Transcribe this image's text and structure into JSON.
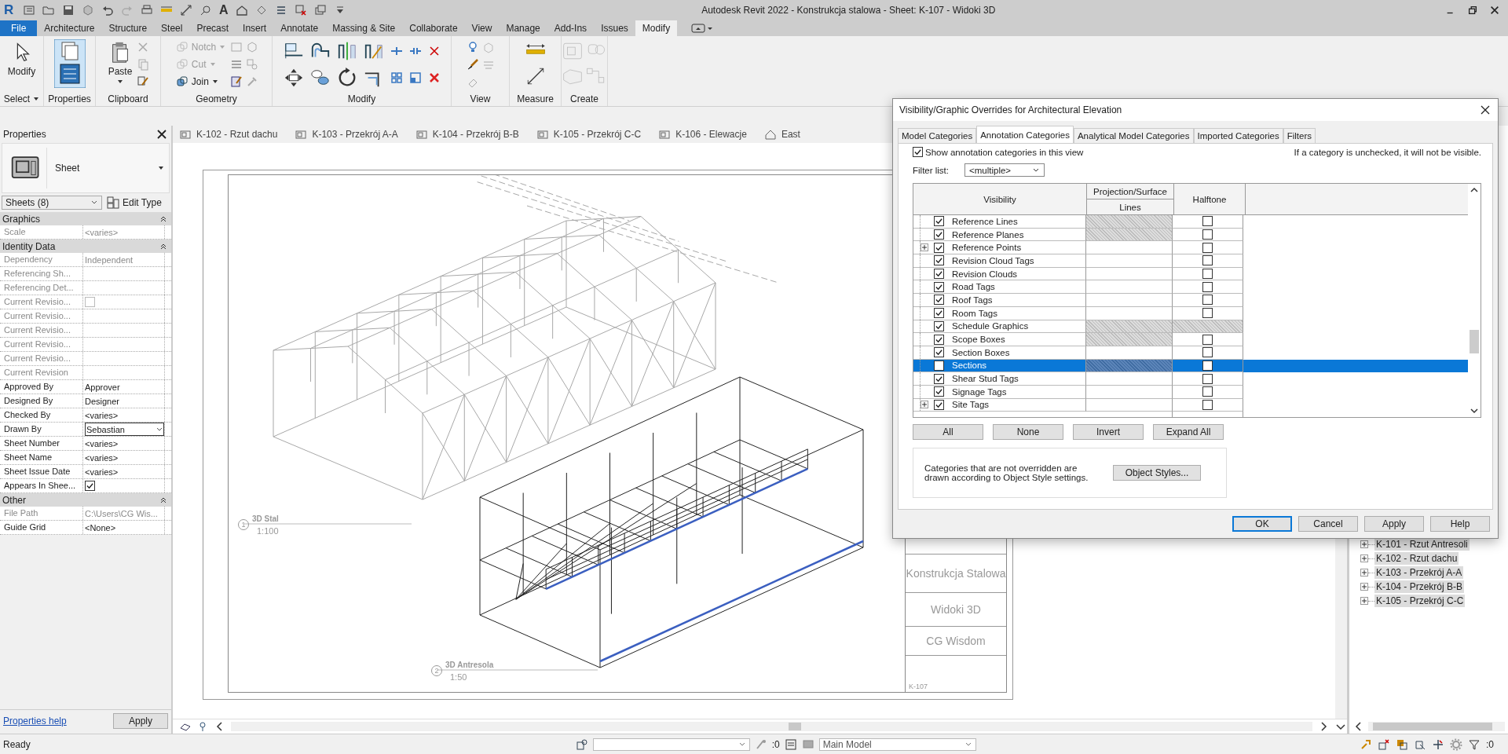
{
  "window": {
    "logo": "R",
    "text_tool": "A",
    "title": "Autodesk Revit 2022 - Konstrukcja stalowa - Sheet: K-107 - Widoki 3D"
  },
  "ribbon_tabs": [
    {
      "label": "File",
      "kind": "file",
      "selected": false
    },
    {
      "label": "Architecture",
      "kind": "tab",
      "selected": false
    },
    {
      "label": "Structure",
      "kind": "tab",
      "selected": false
    },
    {
      "label": "Steel",
      "kind": "tab",
      "selected": false
    },
    {
      "label": "Precast",
      "kind": "tab",
      "selected": false
    },
    {
      "label": "Insert",
      "kind": "tab",
      "selected": false
    },
    {
      "label": "Annotate",
      "kind": "tab",
      "selected": false
    },
    {
      "label": "Massing & Site",
      "kind": "tab",
      "selected": false
    },
    {
      "label": "Collaborate",
      "kind": "tab",
      "selected": false
    },
    {
      "label": "View",
      "kind": "tab",
      "selected": false
    },
    {
      "label": "Manage",
      "kind": "tab",
      "selected": false
    },
    {
      "label": "Add-Ins",
      "kind": "tab",
      "selected": false
    },
    {
      "label": "Issues",
      "kind": "tab",
      "selected": false
    },
    {
      "label": "Modify",
      "kind": "tab",
      "selected": true
    }
  ],
  "ribbon_panels": [
    {
      "kind": "select",
      "label": "Select",
      "tool": "Modify",
      "has_menu": true
    },
    {
      "kind": "properties",
      "label": "Properties",
      "on": true
    },
    {
      "kind": "clipboard",
      "label": "Clipboard",
      "tool": "Paste"
    },
    {
      "kind": "geometry",
      "label": "Geometry",
      "tools": [
        {
          "label": "Notch",
          "disabled": true
        },
        {
          "label": "Cut",
          "disabled": true
        },
        {
          "label": "Join",
          "disabled": false
        }
      ]
    },
    {
      "kind": "modify",
      "label": "Modify"
    },
    {
      "kind": "view",
      "label": "View"
    },
    {
      "kind": "measure",
      "label": "Measure"
    },
    {
      "kind": "create",
      "label": "Create"
    }
  ],
  "properties": {
    "title": "Properties",
    "type_name": "Sheet",
    "selector": "Sheets (8)",
    "edit_type": "Edit Type",
    "groups": [
      {
        "name": "Graphics",
        "expanded": true,
        "rows": [
          {
            "label": "Scale",
            "value": "<varies>",
            "kind": "text",
            "disabled": true
          }
        ]
      },
      {
        "name": "Identity Data",
        "expanded": true,
        "rows": [
          {
            "label": "Dependency",
            "value": "Independent",
            "kind": "text",
            "disabled": true
          },
          {
            "label": "Referencing Sh...",
            "kind": "text",
            "disabled": true
          },
          {
            "label": "Referencing Det...",
            "kind": "text",
            "disabled": true
          },
          {
            "label": "Current Revisio...",
            "kind": "checkbox",
            "checked": false,
            "disabled": true
          },
          {
            "label": "Current Revisio...",
            "kind": "text",
            "disabled": true
          },
          {
            "label": "Current Revisio...",
            "kind": "text",
            "disabled": true
          },
          {
            "label": "Current Revisio...",
            "kind": "text",
            "disabled": true
          },
          {
            "label": "Current Revisio...",
            "kind": "text",
            "disabled": true
          },
          {
            "label": "Current Revision",
            "kind": "text",
            "disabled": true
          },
          {
            "label": "Approved By",
            "value": "Approver",
            "kind": "text",
            "disabled": false
          },
          {
            "label": "Designed By",
            "value": "Designer",
            "kind": "text",
            "disabled": false
          },
          {
            "label": "Checked By",
            "value": "<varies>",
            "kind": "text",
            "disabled": false
          },
          {
            "label": "Drawn By",
            "value": "Sebastian",
            "kind": "dropdown",
            "disabled": false
          },
          {
            "label": "Sheet Number",
            "value": "<varies>",
            "kind": "text",
            "disabled": false
          },
          {
            "label": "Sheet Name",
            "value": "<varies>",
            "kind": "text",
            "disabled": false
          },
          {
            "label": "Sheet Issue Date",
            "value": "<varies>",
            "kind": "text",
            "disabled": false
          },
          {
            "label": "Appears In Shee...",
            "kind": "checkbox",
            "checked": true,
            "disabled": false
          }
        ]
      },
      {
        "name": "Other",
        "expanded": true,
        "rows": [
          {
            "label": "File Path",
            "value": "C:\\Users\\CG Wis...",
            "kind": "text",
            "disabled": true
          },
          {
            "label": "Guide Grid",
            "value": "<None>",
            "kind": "text",
            "disabled": false
          }
        ]
      }
    ],
    "help_link": "Properties help",
    "apply": "Apply"
  },
  "view_tabs": [
    {
      "label": "K-102 - Rzut dachu",
      "kind": "sheet"
    },
    {
      "label": "K-103 - Przekrój A-A",
      "kind": "sheet"
    },
    {
      "label": "K-104 - Przekrój B-B",
      "kind": "sheet"
    },
    {
      "label": "K-105 - Przekrój C-C",
      "kind": "sheet"
    },
    {
      "label": "K-106 - Elewacje",
      "kind": "sheet"
    },
    {
      "label": "East",
      "kind": "elevation"
    }
  ],
  "sheet": {
    "views": [
      {
        "number": "1",
        "name": "3D Stal",
        "scale": "1:100"
      },
      {
        "number": "2",
        "name": "3D Antresola",
        "scale": "1:50"
      }
    ],
    "title_block": {
      "project": "Konstrukcja Stalowa",
      "sheet_name": "Widoki 3D",
      "company": "CG Wisdom",
      "sheet_number": "K-107"
    }
  },
  "dialog": {
    "title": "Visibility/Graphic Overrides for Architectural Elevation",
    "tabs": [
      {
        "label": "Model Categories",
        "selected": false
      },
      {
        "label": "Annotation Categories",
        "selected": true
      },
      {
        "label": "Analytical Model Categories",
        "selected": false
      },
      {
        "label": "Imported Categories",
        "selected": false
      },
      {
        "label": "Filters",
        "selected": false
      }
    ],
    "show_checkbox": {
      "label": "Show annotation categories in this view",
      "checked": true
    },
    "note": "If a category is unchecked, it will not be visible.",
    "filter_label": "Filter list:",
    "filter_value": "<multiple>",
    "columns": {
      "visibility": "Visibility",
      "projection": "Projection/Surface",
      "lines": "Lines",
      "halftone": "Halftone"
    },
    "rows": [
      {
        "name": "Reference Lines",
        "visible": true,
        "selected": false,
        "expandable": false,
        "lines_editable": false,
        "halftone_editable": true,
        "halftone": false
      },
      {
        "name": "Reference Planes",
        "visible": true,
        "selected": false,
        "expandable": false,
        "lines_editable": false,
        "halftone_editable": true,
        "halftone": false
      },
      {
        "name": "Reference Points",
        "visible": true,
        "selected": false,
        "expandable": true,
        "lines_editable": true,
        "halftone_editable": true,
        "halftone": false
      },
      {
        "name": "Revision Cloud Tags",
        "visible": true,
        "selected": false,
        "expandable": false,
        "lines_editable": true,
        "halftone_editable": true,
        "halftone": false
      },
      {
        "name": "Revision Clouds",
        "visible": true,
        "selected": false,
        "expandable": false,
        "lines_editable": true,
        "halftone_editable": true,
        "halftone": false
      },
      {
        "name": "Road Tags",
        "visible": true,
        "selected": false,
        "expandable": false,
        "lines_editable": true,
        "halftone_editable": true,
        "halftone": false
      },
      {
        "name": "Roof Tags",
        "visible": true,
        "selected": false,
        "expandable": false,
        "lines_editable": true,
        "halftone_editable": true,
        "halftone": false
      },
      {
        "name": "Room Tags",
        "visible": true,
        "selected": false,
        "expandable": false,
        "lines_editable": true,
        "halftone_editable": true,
        "halftone": false
      },
      {
        "name": "Schedule Graphics",
        "visible": true,
        "selected": false,
        "expandable": false,
        "lines_editable": false,
        "halftone_editable": false
      },
      {
        "name": "Scope Boxes",
        "visible": true,
        "selected": false,
        "expandable": false,
        "lines_editable": false,
        "halftone_editable": true,
        "halftone": false
      },
      {
        "name": "Section Boxes",
        "visible": true,
        "selected": false,
        "expandable": false,
        "lines_editable": true,
        "halftone_editable": true,
        "halftone": false
      },
      {
        "name": "Sections",
        "visible": false,
        "selected": true,
        "expandable": false,
        "lines_editable": false,
        "halftone_editable": true,
        "halftone": false
      },
      {
        "name": "Shear Stud Tags",
        "visible": true,
        "selected": false,
        "expandable": false,
        "lines_editable": true,
        "halftone_editable": true,
        "halftone": false
      },
      {
        "name": "Signage Tags",
        "visible": true,
        "selected": false,
        "expandable": false,
        "lines_editable": true,
        "halftone_editable": true,
        "halftone": false
      },
      {
        "name": "Site Tags",
        "visible": true,
        "selected": false,
        "expandable": true,
        "lines_editable": true,
        "halftone_editable": true,
        "halftone": false
      }
    ],
    "list_buttons": [
      "All",
      "None",
      "Invert",
      "Expand All"
    ],
    "info": "Categories that are not overridden are drawn according to Object Style settings.",
    "object_styles": "Object Styles...",
    "footer_buttons": [
      {
        "label": "OK",
        "default": true
      },
      {
        "label": "Cancel",
        "default": false
      },
      {
        "label": "Apply",
        "default": false
      },
      {
        "label": "Help",
        "default": false
      }
    ]
  },
  "project_browser": {
    "items": [
      {
        "label": "K-101 - Rzut Antresoli",
        "selected": true
      },
      {
        "label": "K-102 - Rzut dachu",
        "selected": true
      },
      {
        "label": "K-103 - Przekrój A-A",
        "selected": true
      },
      {
        "label": "K-104 - Przekrój B-B",
        "selected": true
      },
      {
        "label": "K-105 - Przekrój C-C",
        "selected": true
      }
    ]
  },
  "status_bar": {
    "text": "Ready",
    "select_count": ":0",
    "model": "Main Model",
    "filter_count": ":0"
  }
}
